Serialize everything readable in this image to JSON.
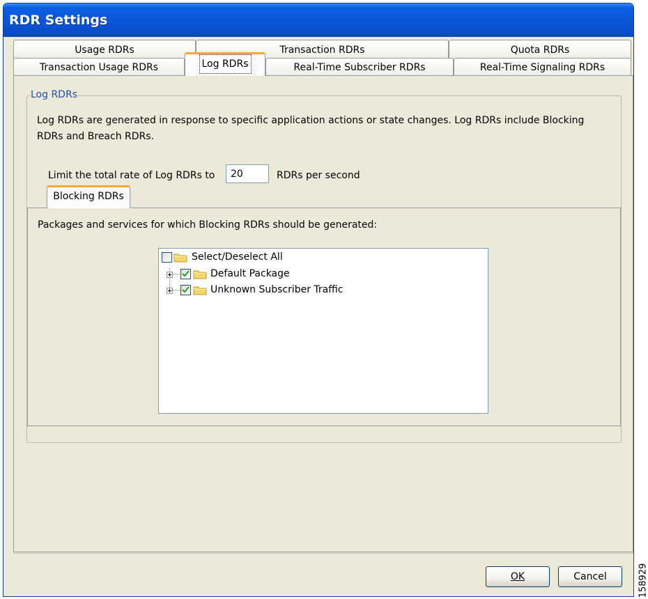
{
  "window": {
    "title": "RDR Settings"
  },
  "tabs": {
    "row1": [
      "Usage RDRs",
      "Transaction RDRs",
      "Quota RDRs"
    ],
    "row2": [
      "Transaction Usage RDRs",
      "Log RDRs",
      "Real-Time Subscriber RDRs",
      "Real-Time Signaling RDRs"
    ],
    "active": "Log RDRs"
  },
  "log_rdrs": {
    "group_title": "Log RDRs",
    "description": "Log RDRs are generated in response to specific application actions or state changes. Log RDRs include Blocking RDRs and Breach RDRs.",
    "rate_label": "Limit the total rate of Log RDRs to",
    "rate_value": "20",
    "rate_unit": "RDRs per second"
  },
  "blocking": {
    "tab_label": "Blocking RDRs",
    "instruction": "Packages and services for which Blocking RDRs should be generated:",
    "tree": [
      {
        "label": "Select/Deselect All",
        "checked": false,
        "expandable": false
      },
      {
        "label": "Default Package",
        "checked": true,
        "expandable": true
      },
      {
        "label": "Unknown Subscriber Traffic",
        "checked": true,
        "expandable": true
      }
    ]
  },
  "buttons": {
    "ok": "OK",
    "cancel": "Cancel"
  },
  "figure_id": "158929",
  "icons": {
    "checkbox_check": "check-icon",
    "folder": "folder-icon",
    "expand": "plus-expander-icon"
  },
  "colors": {
    "title_bar": "#0a55d7",
    "tab_highlight": "#f9a834",
    "group_title": "#1f4fb8",
    "dialog_bg": "#ece9d8"
  }
}
